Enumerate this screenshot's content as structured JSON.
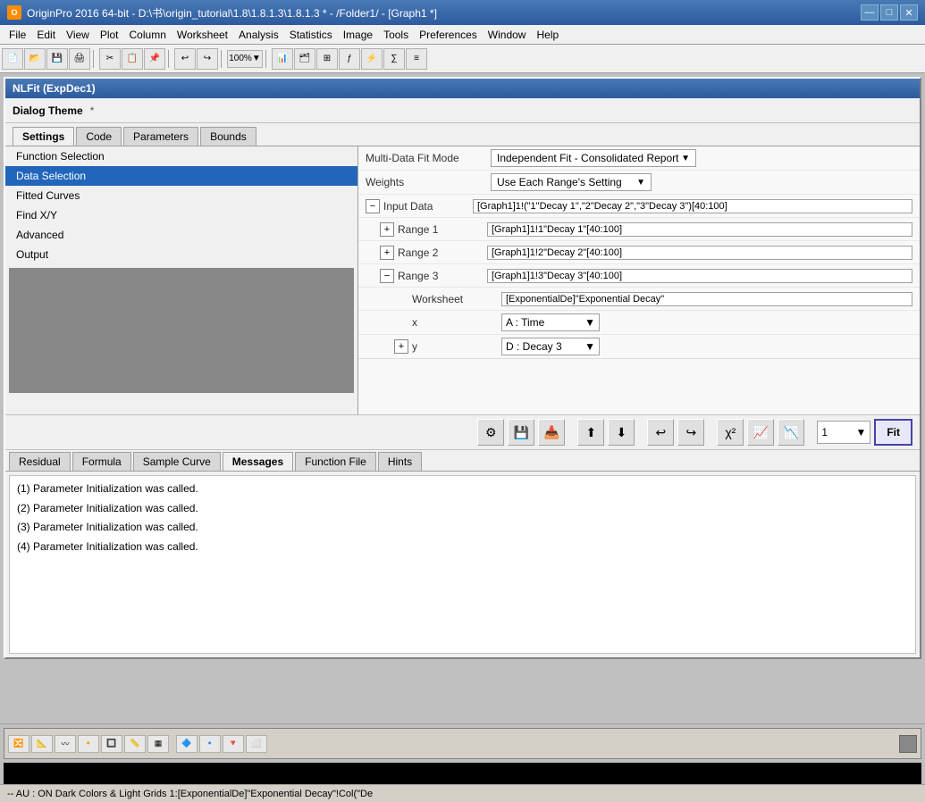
{
  "titlebar": {
    "title": "OriginPro 2016 64-bit - D:\\书\\origin_tutorial\\1.8\\1.8.1.3\\1.8.1.3 * - /Folder1/ - [Graph1 *]",
    "icon": "O",
    "minimize": "—",
    "maximize": "□",
    "close": "✕"
  },
  "dialog": {
    "title": "NLFit (ExpDec1)",
    "theme_label": "Dialog Theme",
    "theme_asterisk": "*"
  },
  "settings_tabs": {
    "items": [
      {
        "label": "Settings",
        "active": true
      },
      {
        "label": "Code",
        "active": false
      },
      {
        "label": "Parameters",
        "active": false
      },
      {
        "label": "Bounds",
        "active": false
      }
    ]
  },
  "nav_items": [
    {
      "label": "Function Selection",
      "selected": false
    },
    {
      "label": "Data Selection",
      "selected": true
    },
    {
      "label": "Fitted Curves",
      "selected": false
    },
    {
      "label": "Find X/Y",
      "selected": false
    },
    {
      "label": "Advanced",
      "selected": false
    },
    {
      "label": "Output",
      "selected": false
    }
  ],
  "right_panel": {
    "multidata_label": "Multi-Data Fit Mode",
    "multidata_value": "Independent Fit - Consolidated Report",
    "weights_label": "Weights",
    "weights_value": "Use Each Range's Setting",
    "input_data_label": "Input Data",
    "input_data_value": "[Graph1]1!(\"1\"Decay 1\",\"2\"Decay 2\",\"3\"Decay 3\")[40:100]",
    "range1_label": "Range 1",
    "range1_value": "[Graph1]1!1\"Decay 1\"[40:100]",
    "range2_label": "Range 2",
    "range2_value": "[Graph1]1!2\"Decay 2\"[40:100]",
    "range3_label": "Range 3",
    "range3_value": "[Graph1]1!3\"Decay 3\"[40:100]",
    "worksheet_label": "Worksheet",
    "worksheet_value": "[ExponentialDe]\"Exponential Decay\"",
    "x_label": "x",
    "x_value": "A : Time",
    "y_label": "y",
    "y_value": "D : Decay 3"
  },
  "bottom_toolbar": {
    "iteration_label": "1",
    "fit_label": "Fit"
  },
  "bottom_tabs": {
    "items": [
      {
        "label": "Residual",
        "active": false
      },
      {
        "label": "Formula",
        "active": false
      },
      {
        "label": "Sample Curve",
        "active": false
      },
      {
        "label": "Messages",
        "active": true
      },
      {
        "label": "Function File",
        "active": false
      },
      {
        "label": "Hints",
        "active": false
      }
    ]
  },
  "messages": [
    "(1) Parameter Initialization was called.",
    "(2) Parameter Initialization was called.",
    "(3) Parameter Initialization was called.",
    "(4) Parameter Initialization was called."
  ],
  "status_bar": {
    "text": "-- AU : ON  Dark Colors & Light Grids  1:[ExponentialDe]\"Exponential Decay\"!Col(\"De"
  }
}
